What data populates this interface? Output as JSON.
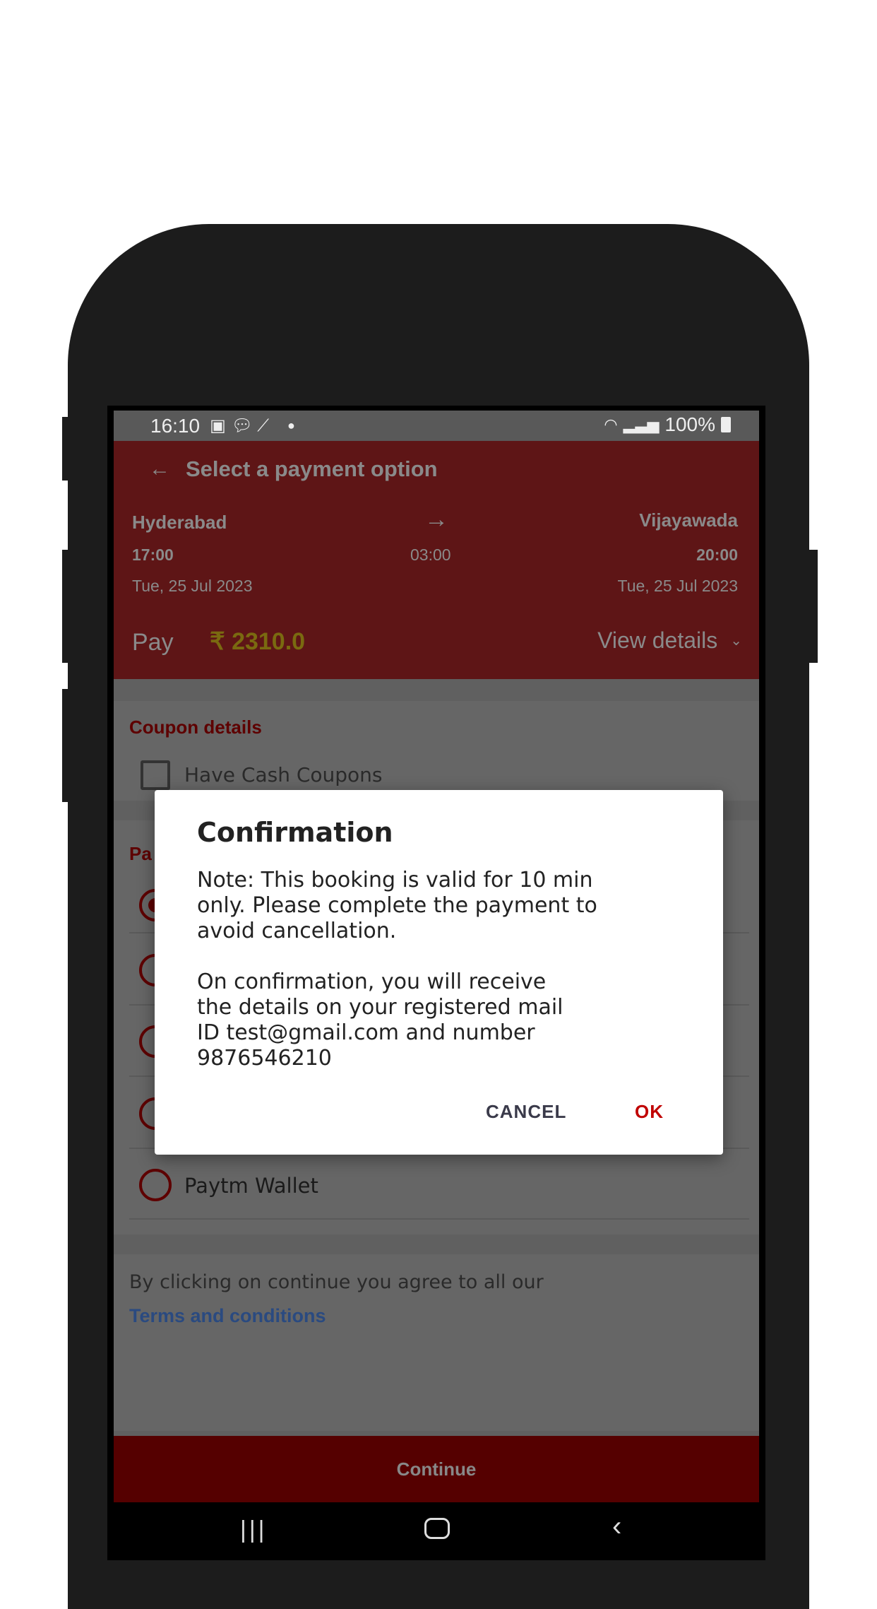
{
  "status_bar": {
    "time": "16:10",
    "battery": "100%",
    "icons": [
      "image-icon",
      "message-icon",
      "magic-wand-icon",
      "dot-icon",
      "wifi-icon",
      "signal-icon",
      "battery-icon"
    ]
  },
  "header": {
    "title": "Select a payment option",
    "back_icon": "arrow-left-icon",
    "origin": {
      "city": "Hyderabad",
      "time": "17:00",
      "date": "Tue, 25 Jul 2023"
    },
    "duration": "03:00",
    "destination": {
      "city": "Vijayawada",
      "time": "20:00",
      "date": "Tue, 25 Jul 2023"
    },
    "pay_label": "Pay",
    "amount": "₹ 2310.0",
    "view_details": "View details"
  },
  "coupon": {
    "title": "Coupon details",
    "checkbox_label": "Have Cash Coupons",
    "checked": false
  },
  "payment": {
    "title_visible": "Pa",
    "options": [
      {
        "label": "",
        "selected": true
      },
      {
        "label": "",
        "selected": false
      },
      {
        "label": "",
        "selected": false
      },
      {
        "label": "",
        "selected": false
      },
      {
        "label": "Paytm Wallet",
        "selected": false
      }
    ]
  },
  "terms": {
    "text": "By clicking on continue you agree to all our",
    "link": "Terms and conditions"
  },
  "continue_label": "Continue",
  "dialog": {
    "title": "Confirmation",
    "body": "Note: This booking is valid for 10 min\nonly. Please complete the payment to\navoid cancellation.\n\nOn confirmation, you will receive\nthe details on your registered mail\nID test@gmail.com and number\n9876546210",
    "cancel": "CANCEL",
    "ok": "OK"
  },
  "colors": {
    "header": "#5e1516",
    "accent": "#c00000",
    "amount": "#7a6a10",
    "link": "#2a4a80",
    "continue": "#550000"
  }
}
